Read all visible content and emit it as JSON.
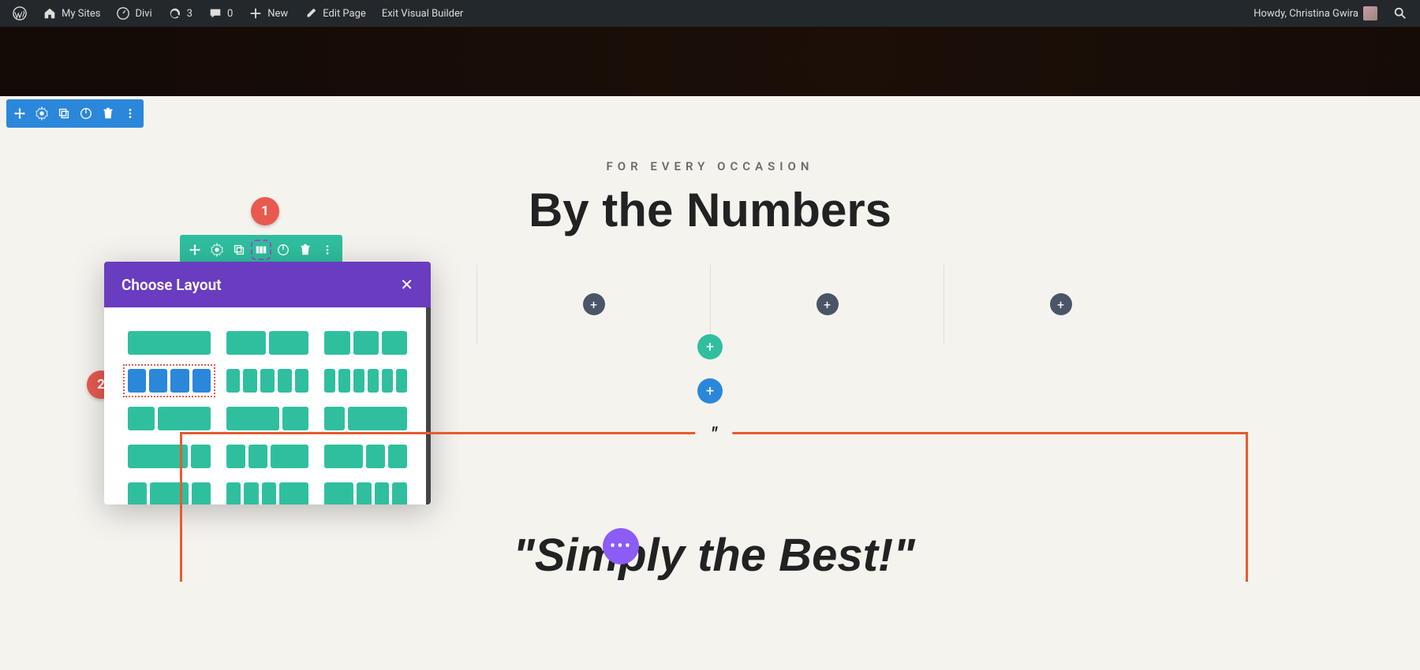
{
  "adminBar": {
    "mySites": "My Sites",
    "siteName": "Divi",
    "updates": "3",
    "comments": "0",
    "new": "New",
    "editPage": "Edit Page",
    "exitVB": "Exit Visual Builder",
    "greeting": "Howdy, Christina Gwira"
  },
  "page": {
    "eyebrow": "FOR EVERY OCCASION",
    "heading": "By the Numbers",
    "quote": "\"Simply the Best!\"",
    "quoteMark": "\""
  },
  "modal": {
    "title": "Choose Layout"
  },
  "annotations": {
    "step1": "1",
    "step2": "2"
  },
  "colors": {
    "sectionBlue": "#2b87da",
    "rowTeal": "#2fbf9f",
    "modalPurple": "#6a3cc0",
    "accentRed": "#e85a4f",
    "borderOrange": "#e85a2f",
    "fabPurple": "#8b5cf6"
  }
}
